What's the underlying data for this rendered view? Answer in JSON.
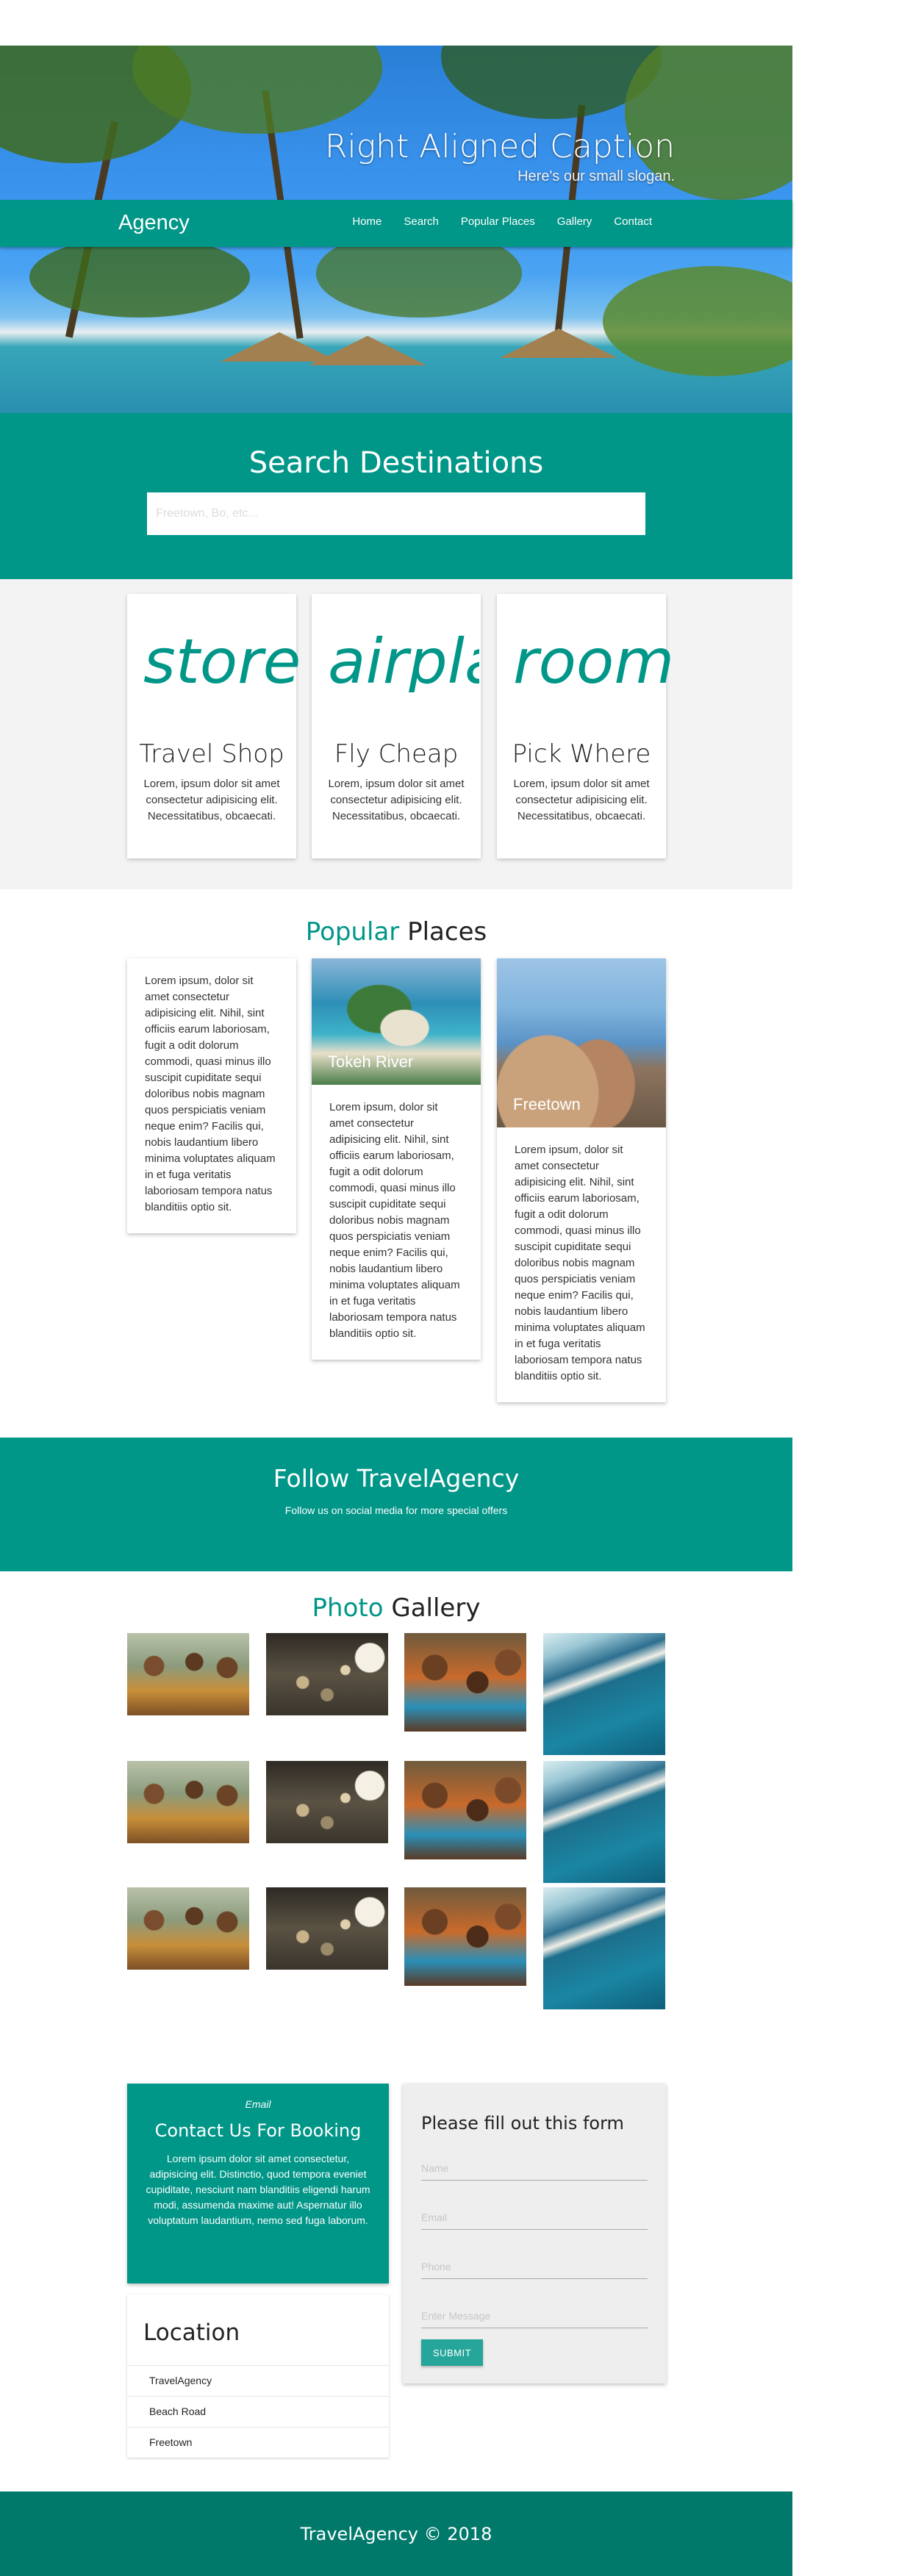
{
  "hero": {
    "caption": "Right Aligned Caption",
    "slogan": "Here's our small slogan."
  },
  "nav": {
    "brand": "Agency",
    "links": [
      "Home",
      "Search",
      "Popular Places",
      "Gallery",
      "Contact"
    ]
  },
  "search": {
    "title": "Search Destinations",
    "placeholder": "Freetown, Bo, etc..."
  },
  "features": [
    {
      "icon": "store",
      "title": "Travel Shop",
      "desc": "Lorem, ipsum dolor sit amet consectetur adipisicing elit. Necessitatibus, obcaecati."
    },
    {
      "icon": "airplanemode_active",
      "title": "Fly Cheap",
      "desc": "Lorem, ipsum dolor sit amet consectetur adipisicing elit. Necessitatibus, obcaecati."
    },
    {
      "icon": "room",
      "title": "Pick Where",
      "desc": "Lorem, ipsum dolor sit amet consectetur adipisicing elit. Necessitatibus, obcaecati."
    }
  ],
  "popular": {
    "title_accent": "Popular",
    "title_rest": "Places",
    "cards": [
      {
        "caption": "",
        "text": "Lorem ipsum, dolor sit amet consectetur adipisicing elit. Nihil, sint officiis earum laboriosam, fugit a odit dolorum commodi, quasi minus illo suscipit cupiditate sequi doloribus nobis magnam quos perspiciatis veniam neque enim? Facilis qui, nobis laudantium libero minima voluptates aliquam in et fuga veritatis laboriosam tempora natus blanditiis optio sit."
      },
      {
        "caption": "Tokeh River",
        "text": "Lorem ipsum, dolor sit amet consectetur adipisicing elit. Nihil, sint officiis earum laboriosam, fugit a odit dolorum commodi, quasi minus illo suscipit cupiditate sequi doloribus nobis magnam quos perspiciatis veniam neque enim? Facilis qui, nobis laudantium libero minima voluptates aliquam in et fuga veritatis laboriosam tempora natus blanditiis optio sit."
      },
      {
        "caption": "Freetown",
        "text": "Lorem ipsum, dolor sit amet consectetur adipisicing elit. Nihil, sint officiis earum laboriosam, fugit a odit dolorum commodi, quasi minus illo suscipit cupiditate sequi doloribus nobis magnam quos perspiciatis veniam neque enim? Facilis qui, nobis laudantium libero minima voluptates aliquam in et fuga veritatis laboriosam tempora natus blanditiis optio sit."
      }
    ]
  },
  "follow": {
    "title": "Follow TravelAgency",
    "subtitle": "Follow us on social media for more special offers"
  },
  "gallery": {
    "title_accent": "Photo",
    "title_rest": "Gallery"
  },
  "contact": {
    "email_label": "Email",
    "title": "Contact Us For Booking",
    "desc": "Lorem ipsum dolor sit amet consectetur, adipisicing elit. Distinctio, quod tempora eveniet cupiditate, nesciunt nam blanditiis eligendi harum modi, assumenda maxime aut! Aspernatur illo voluptatum laudantium, nemo sed fuga laborum."
  },
  "location": {
    "title": "Location",
    "items": [
      "TravelAgency",
      "Beach Road",
      "Freetown"
    ]
  },
  "form": {
    "title": "Please fill out this form",
    "name_placeholder": "Name",
    "email_placeholder": "Email",
    "phone_placeholder": "Phone",
    "message_placeholder": "Enter Message",
    "submit_label": "SUBMIT"
  },
  "footer": {
    "text": "TravelAgency © 2018"
  },
  "colors": {
    "accent": "#009688",
    "footer": "#00796b",
    "button": "#26a69a"
  }
}
